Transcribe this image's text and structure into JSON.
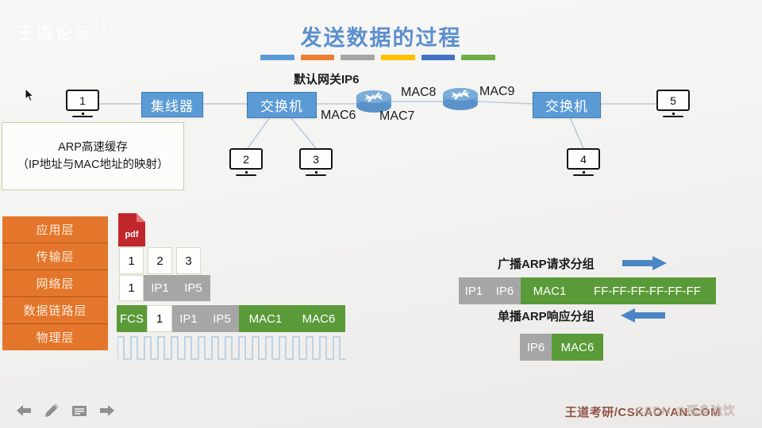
{
  "slide": {
    "title": "发送数据的过程",
    "watermark_top": "王道论坛",
    "watermark_footer": "王道考研/CSKAOYAN.COM",
    "watermark_csdn": "CSDN @孤身独饮",
    "accent_title_color": "#5b8fce",
    "bar_colors": [
      "#5b9bd5",
      "#ed7d31",
      "#a5a5a5",
      "#ffc000",
      "#4472c4",
      "#70ad47"
    ]
  },
  "network": {
    "gateway_label": "默认网关IP6",
    "hub_label": "集线器",
    "switch_left_label": "交换机",
    "switch_right_label": "交换机",
    "hosts": [
      "1",
      "2",
      "3",
      "4",
      "5"
    ],
    "mac_labels": [
      "MAC6",
      "MAC7",
      "MAC8",
      "MAC9"
    ],
    "arp_cache_line1": "ARP高速缓存",
    "arp_cache_line2": "（IP地址与MAC地址的映射）"
  },
  "osi_layers": [
    "应用层",
    "传输层",
    "网络层",
    "数据链路层",
    "物理层"
  ],
  "encapsulation": {
    "file_icon_label": "pdf",
    "row_app": [
      "1",
      "2",
      "3"
    ],
    "row_net": [
      "1",
      "IP1",
      "IP5"
    ],
    "row_link": [
      "FCS",
      "1",
      "IP1",
      "IP5",
      "MAC1",
      "MAC6"
    ],
    "signal_cycles": 17
  },
  "arp_exchange": {
    "request_caption": "广播ARP请求分组",
    "response_caption": "单播ARP响应分组",
    "request_fields": [
      "IP1",
      "IP6",
      "MAC1",
      "FF-FF-FF-FF-FF-FF"
    ],
    "response_fields": [
      "IP6",
      "MAC6"
    ],
    "arrow_color": "#4a86c5"
  },
  "toolbar": {
    "items": [
      "back-arrow-icon",
      "pencil-icon",
      "note-icon",
      "forward-arrow-icon"
    ]
  }
}
